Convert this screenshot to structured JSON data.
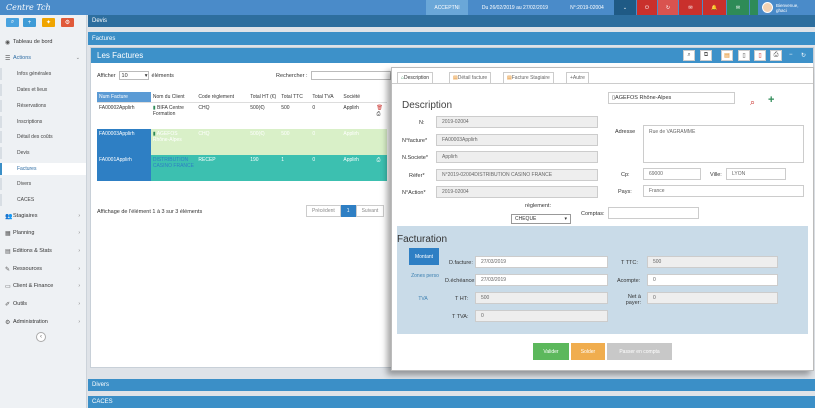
{
  "app": {
    "title": "Centre Tch"
  },
  "topbar": {
    "account": "ACCEPTNI",
    "dates": "Du 26/02/2019 au 27/02/2019",
    "invoice_no": "N°:2019-02004",
    "welcome": "Bienvenue,",
    "user": "ghaci"
  },
  "breadcrumb": "Devis",
  "section_bar": "Factures",
  "sidebar": {
    "dashboard": "Tableau de bord",
    "actions": "Actions",
    "subitems": [
      "Infos générales",
      "Dates et lieux",
      "Réservations",
      "Inscriptions",
      "Détail des coûts",
      "Devis",
      "Factures",
      "Divers",
      "CACES"
    ],
    "groups": [
      "Stagiaires",
      "Planning",
      "Editions & Stats",
      "Ressources",
      "Client & Finance",
      "Outils",
      "Administration"
    ]
  },
  "panel": {
    "title": "Les Factures"
  },
  "table": {
    "show_label": "Afficher",
    "show_value": "10",
    "entries_label": "éléments",
    "search_label": "Rechercher :",
    "headers": [
      "Num Facture",
      "Nom du Client",
      "Code règlement",
      "Total HT (€)",
      "Total TTC",
      "Total TVA",
      "Société"
    ],
    "rows": [
      {
        "num": "FA00002Applirh",
        "client": "BIFA Centre Formation",
        "code": "CHQ",
        "ht": "500(€)",
        "ttc": "500",
        "tva": "0",
        "societe": "Applirh"
      },
      {
        "num": "FA00003Applirh",
        "client": "AGEFOS Rhône-Alpes",
        "code": "CHQ",
        "ht": "500(€)",
        "ttc": "500",
        "tva": "0",
        "societe": "Applirh"
      },
      {
        "num": "FA0001Applirh",
        "client": "DISTRIBUTION CASINO FRANCE",
        "code": "RECEP",
        "ht": "190",
        "ttc": "1",
        "tva": "0",
        "societe": "Applirh"
      }
    ],
    "info": "Affichage de l'élément 1 à 3 sur 3 éléments",
    "prev": "Précédent",
    "page": "1",
    "next": "Suivant"
  },
  "modal": {
    "tabs": [
      "Description",
      "Détail facture",
      "Facture Stagiaire",
      "Autre"
    ],
    "heading": "Description",
    "client_select": "AGEFOS Rhône-Alpes",
    "labels": {
      "n": "N:",
      "nfacture": "N°facture*",
      "nsociete": "N.Societe*",
      "refer": "Réfer*",
      "naction": "N°Action*",
      "adresse": "Adresse",
      "cp": "Cp:",
      "ville": "Ville:",
      "pays": "Pays:",
      "reglement": "règlement:",
      "comptas": "Comptas:"
    },
    "values": {
      "n": "2019-02004",
      "nfacture": "FA00003Applirh",
      "nsociete": "Applirh",
      "refer": "N°2019-02004DISTRIBUTION CASINO FRANCE",
      "naction": "2019-02004",
      "adresse": "Rue de VAGRAMME",
      "cp": "69000",
      "ville": "LYON",
      "pays": "France",
      "reglement": "CHEQUE",
      "comptas": ""
    },
    "facturation": {
      "heading": "Facturation",
      "side": [
        "Montant",
        "Zones perso",
        "TVA"
      ],
      "labels": {
        "dfacture": "D.facture:",
        "decheance": "D.échéance:",
        "ht": "T HT:",
        "tva": "T TVA:",
        "ttc": "T TTC:",
        "acompte": "Acompte:",
        "net": "Net à payer:"
      },
      "values": {
        "dfacture": "27/03/2019",
        "decheance": "27/03/2019",
        "ht": "500",
        "tva": "0",
        "ttc": "500",
        "acompte": "0",
        "net": "0"
      }
    },
    "buttons": {
      "validate": "Valider",
      "solder": "Solder",
      "compta": "Passer en compta"
    }
  },
  "bottom": {
    "divers": "Divers",
    "caces": "CACES"
  },
  "colors": {
    "topbar": "#4a8bc9",
    "header": "#3d91c9",
    "selected_row": "#2e7fc4",
    "teal_row": "#3cc0b0",
    "green_row": "#d9f0c8",
    "validate": "#5cb85c",
    "solder": "#f0ad4e"
  }
}
